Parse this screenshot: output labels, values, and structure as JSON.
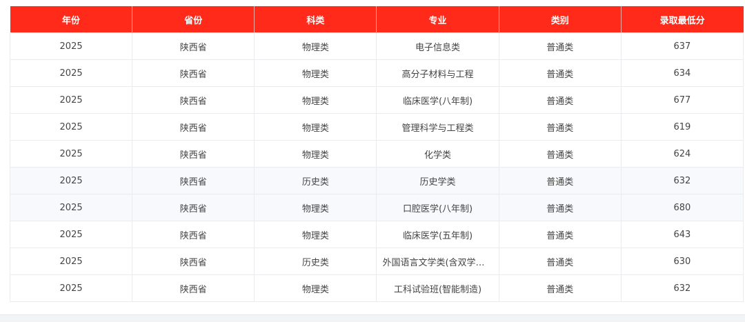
{
  "table": {
    "headers": [
      "年份",
      "省份",
      "科类",
      "专业",
      "类别",
      "录取最低分"
    ],
    "rows": [
      [
        "2025",
        "陕西省",
        "物理类",
        "电子信息类",
        "普通类",
        "637"
      ],
      [
        "2025",
        "陕西省",
        "物理类",
        "高分子材料与工程",
        "普通类",
        "634"
      ],
      [
        "2025",
        "陕西省",
        "物理类",
        "临床医学(八年制)",
        "普通类",
        "677"
      ],
      [
        "2025",
        "陕西省",
        "物理类",
        "管理科学与工程类",
        "普通类",
        "619"
      ],
      [
        "2025",
        "陕西省",
        "物理类",
        "化学类",
        "普通类",
        "624"
      ],
      [
        "2025",
        "陕西省",
        "历史类",
        "历史学类",
        "普通类",
        "632"
      ],
      [
        "2025",
        "陕西省",
        "物理类",
        "口腔医学(八年制)",
        "普通类",
        "680"
      ],
      [
        "2025",
        "陕西省",
        "物理类",
        "临床医学(五年制)",
        "普通类",
        "643"
      ],
      [
        "2025",
        "陕西省",
        "历史类",
        "外国语言文学类(含双学士…",
        "普通类",
        "630"
      ],
      [
        "2025",
        "陕西省",
        "物理类",
        "工科试验班(智能制造)",
        "普通类",
        "632"
      ]
    ]
  },
  "colors": {
    "header_bg": "#ff2a1a",
    "header_text": "#ffffff",
    "row_alt_bg": "#f7f9fc",
    "cell_text": "#444444"
  }
}
